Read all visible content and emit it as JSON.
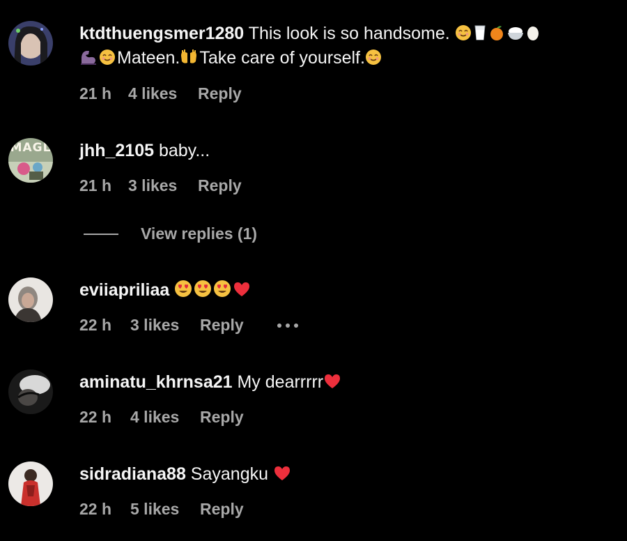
{
  "theme": {
    "background": "#000000",
    "text": "#f5f5f5",
    "muted": "#a8a8a8",
    "heart": "#ed2f3c"
  },
  "comments": [
    {
      "username": "ktdthuengsmer1280",
      "text_line1": " This look is so handsome.",
      "line1_emojis": [
        "smiling-face-icon",
        "glass-of-milk-icon",
        "tangerine-icon",
        "rice-bowl-icon",
        "egg-icon"
      ],
      "text_line2_a": "Mateen.",
      "text_line2_b": "Take care of yourself.",
      "line2_emojis": [
        "flexed-biceps-icon",
        "smiling-face-icon",
        "open-hands-icon",
        "smiling-face-icon"
      ],
      "time": "21 h",
      "likes": "4 likes",
      "reply": "Reply"
    },
    {
      "username": "jhh_2105",
      "text": " baby...",
      "avatar_text": "MAGL",
      "time": "21 h",
      "likes": "3 likes",
      "reply": "Reply"
    },
    {
      "username": "eviiapriliaa",
      "text": " ",
      "emojis": [
        "heart-eyes-icon",
        "heart-eyes-icon",
        "heart-eyes-icon",
        "red-heart-icon"
      ],
      "time": "22 h",
      "likes": "3 likes",
      "reply": "Reply",
      "more_icon": "more-options-icon"
    },
    {
      "username": "aminatu_khrnsa21",
      "text": " My dearrrrr",
      "emojis": [
        "red-heart-icon"
      ],
      "time": "22 h",
      "likes": "4 likes",
      "reply": "Reply"
    },
    {
      "username": "sidradiana88",
      "text": " Sayangku ",
      "emojis": [
        "red-heart-icon"
      ],
      "time": "22 h",
      "likes": "5 likes",
      "reply": "Reply"
    }
  ],
  "view_replies": {
    "label": "View replies (1)"
  }
}
